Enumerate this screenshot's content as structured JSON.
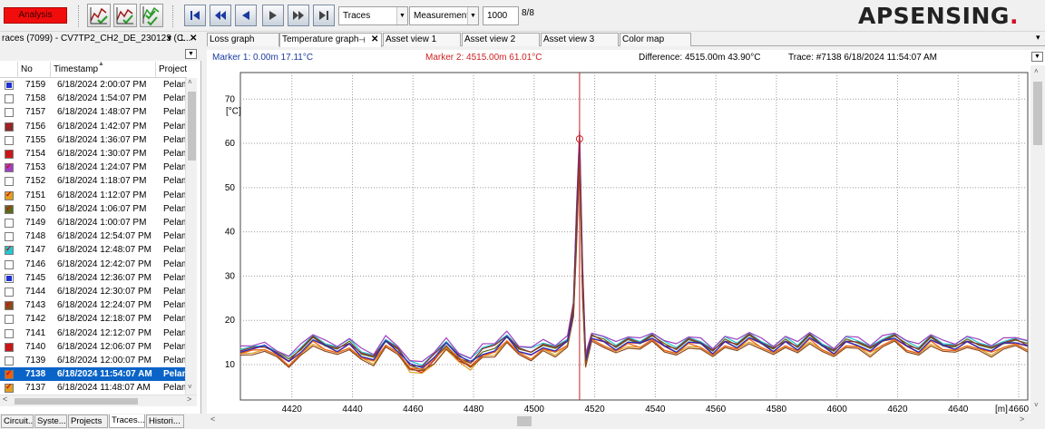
{
  "toolbar": {
    "analysis_label": "Analysis",
    "traces_combo": "Traces",
    "measurement_combo": "Measurement",
    "count_value": "1000",
    "page_indicator": "8/8",
    "brand_logo": "APSENSING."
  },
  "left_panel": {
    "title": "races (7099) - CV7TP2_CH2_DE_230123 (C...",
    "columns": [
      "No",
      "Timestamp",
      "Project"
    ],
    "rows": [
      {
        "no": "7159",
        "ts": "6/18/2024 2:00:07 PM",
        "proj": "Pelam",
        "color": "#1f2fd0",
        "checked": false
      },
      {
        "no": "7158",
        "ts": "6/18/2024 1:54:07 PM",
        "proj": "Pelam",
        "color": "",
        "checked": false
      },
      {
        "no": "7157",
        "ts": "6/18/2024 1:48:07 PM",
        "proj": "Pelam",
        "color": "",
        "checked": false
      },
      {
        "no": "7156",
        "ts": "6/18/2024 1:42:07 PM",
        "proj": "Pelam",
        "color": "#8b2a2a",
        "checked": true
      },
      {
        "no": "7155",
        "ts": "6/18/2024 1:36:07 PM",
        "proj": "Pelam",
        "color": "",
        "checked": false
      },
      {
        "no": "7154",
        "ts": "6/18/2024 1:30:07 PM",
        "proj": "Pelam",
        "color": "#c81818",
        "checked": true
      },
      {
        "no": "7153",
        "ts": "6/18/2024 1:24:07 PM",
        "proj": "Pelam",
        "color": "#a040c0",
        "checked": true
      },
      {
        "no": "7152",
        "ts": "6/18/2024 1:18:07 PM",
        "proj": "Pelam",
        "color": "",
        "checked": false
      },
      {
        "no": "7151",
        "ts": "6/18/2024 1:12:07 PM",
        "proj": "Pelam",
        "color": "#e0a020",
        "checked": true
      },
      {
        "no": "7150",
        "ts": "6/18/2024 1:06:07 PM",
        "proj": "Pelam",
        "color": "#5a6a1a",
        "checked": true
      },
      {
        "no": "7149",
        "ts": "6/18/2024 1:00:07 PM",
        "proj": "Pelam",
        "color": "",
        "checked": false
      },
      {
        "no": "7148",
        "ts": "6/18/2024 12:54:07 PM",
        "proj": "Pelam",
        "color": "",
        "checked": false
      },
      {
        "no": "7147",
        "ts": "6/18/2024 12:48:07 PM",
        "proj": "Pelam",
        "color": "#20c8d0",
        "checked": true
      },
      {
        "no": "7146",
        "ts": "6/18/2024 12:42:07 PM",
        "proj": "Pelam",
        "color": "",
        "checked": false
      },
      {
        "no": "7145",
        "ts": "6/18/2024 12:36:07 PM",
        "proj": "Pelam",
        "color": "#1f2fd0",
        "checked": false
      },
      {
        "no": "7144",
        "ts": "6/18/2024 12:30:07 PM",
        "proj": "Pelam",
        "color": "",
        "checked": false
      },
      {
        "no": "7143",
        "ts": "6/18/2024 12:24:07 PM",
        "proj": "Pelam",
        "color": "#8a4a1a",
        "checked": true
      },
      {
        "no": "7142",
        "ts": "6/18/2024 12:18:07 PM",
        "proj": "Pelam",
        "color": "",
        "checked": false
      },
      {
        "no": "7141",
        "ts": "6/18/2024 12:12:07 PM",
        "proj": "Pelam",
        "color": "",
        "checked": false
      },
      {
        "no": "7140",
        "ts": "6/18/2024 12:06:07 PM",
        "proj": "Pelam",
        "color": "#c81818",
        "checked": true
      },
      {
        "no": "7139",
        "ts": "6/18/2024 12:00:07 PM",
        "proj": "Pelam",
        "color": "",
        "checked": false
      },
      {
        "no": "7138",
        "ts": "6/18/2024 11:54:07 AM",
        "proj": "Pelam",
        "color": "#e86010",
        "checked": true,
        "selected": true
      },
      {
        "no": "7137",
        "ts": "6/18/2024 11:48:07 AM",
        "proj": "Pelam",
        "color": "#e0a020",
        "checked": true
      }
    ],
    "bottom_tabs": [
      "Circuit...",
      "Syste...",
      "Projects",
      "Traces...",
      "Histori..."
    ],
    "active_bottom_tab": 3
  },
  "doc_tabs": [
    "Loss graph",
    "Temperature graph",
    "Asset view 1",
    "Asset view 2",
    "Asset view 3",
    "Color map"
  ],
  "active_doc_tab": 1,
  "info": {
    "marker1": "Marker 1: 0.00m 17.11°C",
    "marker2": "Marker 2: 4515.00m 61.01°C",
    "difference": "Difference: 4515.00m 43.90°C",
    "trace": "Trace: #7138 6/18/2024 11:54:07 AM"
  },
  "colors": {
    "selection": "#0a64c8",
    "marker2": "#cc2020",
    "marker1": "#1a3aa0",
    "logo": "#222222",
    "logo_accent": "#d0102a"
  },
  "chart_data": {
    "type": "line",
    "title": "",
    "xlabel": "[m]",
    "ylabel": "[°C]",
    "xlim": [
      4403,
      4663
    ],
    "ylim": [
      2,
      76
    ],
    "x_ticks": [
      4420,
      4440,
      4460,
      4480,
      4500,
      4520,
      4540,
      4560,
      4580,
      4600,
      4620,
      4640,
      4660
    ],
    "y_ticks": [
      10,
      20,
      30,
      40,
      50,
      60,
      70
    ],
    "grid": true,
    "marker_x": 4515,
    "marker_y": 61.01,
    "series_colors": [
      "#c81818",
      "#e0a020",
      "#5a6a1a",
      "#20c8d0",
      "#a040c0",
      "#8b2a2a",
      "#e86010",
      "#1f2fd0",
      "#8a4a1a"
    ],
    "x": [
      4403,
      4407,
      4411,
      4415,
      4419,
      4423,
      4427,
      4431,
      4435,
      4439,
      4443,
      4447,
      4451,
      4455,
      4459,
      4463,
      4467,
      4471,
      4475,
      4479,
      4483,
      4487,
      4491,
      4495,
      4499,
      4503,
      4507,
      4511,
      4513,
      4514,
      4515,
      4516,
      4517,
      4519,
      4523,
      4527,
      4531,
      4535,
      4539,
      4543,
      4547,
      4551,
      4555,
      4559,
      4563,
      4567,
      4571,
      4575,
      4579,
      4583,
      4587,
      4591,
      4595,
      4599,
      4603,
      4607,
      4611,
      4615,
      4619,
      4623,
      4627,
      4631,
      4635,
      4639,
      4643,
      4647,
      4651,
      4655,
      4659,
      4663
    ],
    "series": [
      {
        "values": [
          13,
          13.5,
          14,
          12.5,
          10.5,
          13,
          15.5,
          14,
          13,
          14.5,
          12,
          11,
          15,
          13,
          9,
          8.5,
          11,
          14,
          11,
          9.5,
          12.5,
          13,
          16,
          13,
          12,
          14,
          13,
          15,
          22,
          40,
          61,
          28,
          10,
          16,
          15,
          13.5,
          15,
          14.5,
          16,
          14,
          13,
          15,
          14.5,
          12.5,
          15,
          14,
          16,
          14.5,
          13,
          15,
          13.5,
          16,
          14,
          12.5,
          15,
          14.5,
          13,
          15,
          16,
          14,
          13,
          15.5,
          14,
          13.5,
          15,
          14,
          13,
          14.5,
          15,
          14
        ]
      },
      {
        "values": [
          13.5,
          14,
          14.5,
          13,
          11.5,
          14,
          16.5,
          15,
          14,
          15.5,
          13,
          12,
          16,
          14,
          10.5,
          10,
          12.5,
          15.5,
          12.5,
          11,
          14,
          14.5,
          17,
          14,
          13.5,
          15,
          14,
          16,
          24,
          45,
          62,
          32,
          12,
          17,
          16,
          14.5,
          16,
          15.5,
          17,
          15,
          14,
          16,
          15.5,
          13.5,
          16,
          15,
          17,
          15.5,
          14,
          16,
          14.5,
          17,
          15,
          13.5,
          16,
          15.5,
          14,
          16,
          17,
          15,
          14,
          16.5,
          15,
          14.5,
          16,
          15,
          14,
          15.5,
          16,
          15
        ]
      },
      {
        "values": [
          12.5,
          13,
          13.5,
          12,
          10,
          12.5,
          15,
          13.5,
          12.5,
          14,
          11.5,
          10.5,
          14.5,
          12.5,
          9.5,
          9,
          11,
          14,
          11.5,
          10,
          12,
          12.5,
          15.5,
          12.5,
          11.5,
          13.5,
          12.5,
          14.5,
          21,
          38,
          58,
          26,
          10,
          15.5,
          14.5,
          13,
          14.5,
          14,
          15.5,
          13.5,
          12.5,
          14.5,
          14,
          12,
          14.5,
          13.5,
          15.5,
          14,
          12.5,
          14.5,
          13,
          15.5,
          13.5,
          12,
          14.5,
          14,
          12.5,
          14.5,
          15.5,
          13.5,
          12.5,
          15,
          13.5,
          13,
          14.5,
          13.5,
          12.5,
          14,
          14.5,
          13.5
        ]
      }
    ]
  }
}
